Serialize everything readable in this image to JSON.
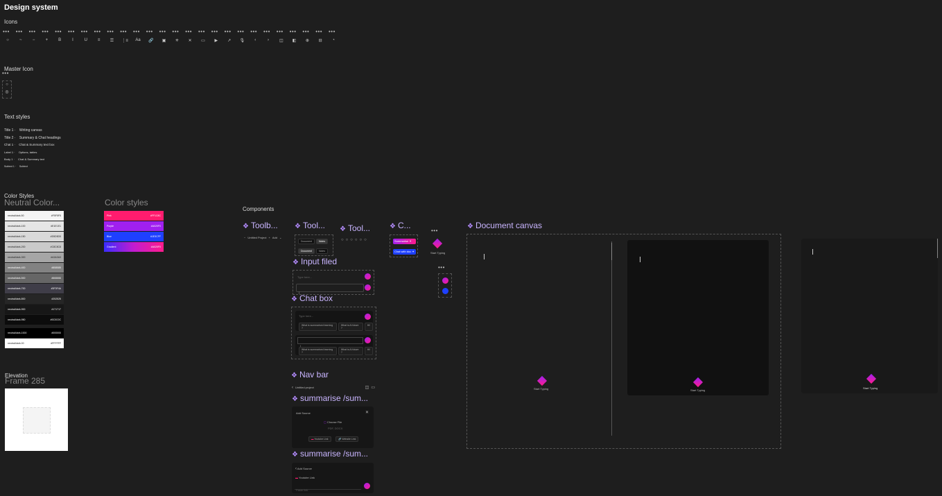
{
  "page": {
    "title": "Design system",
    "icons_label": "Icons",
    "master_icon_label": "Master Icon",
    "text_styles_label": "Text styles",
    "color_styles_label": "Color Styles",
    "neutral_colors_label": "Neutral Color...",
    "color_styles_big_label": "Color styles",
    "elevation_label": "Elevation",
    "frame_label": "Frame 285",
    "components_label": "Components"
  },
  "icons": [
    "○",
    "~",
    "−",
    "+",
    "B",
    "I",
    "U",
    "≡",
    "☰",
    "⋮≡",
    "Aa",
    "🔗",
    "▣",
    "✳",
    "✕",
    "▭",
    "▶",
    "↗",
    "🎙",
    "‹",
    "›",
    "◫",
    "◧",
    "⊕",
    "⊟",
    "◔"
  ],
  "text_styles": [
    {
      "name": "Title 1",
      "sample": "Writing canvas"
    },
    {
      "name": "Title 2",
      "sample": "Summary & Chat headings"
    },
    {
      "name": "Chat 1",
      "sample": "Chat & Summary text box"
    },
    {
      "name": "Label 1",
      "sample": "Options, tables"
    },
    {
      "name": "Body 1",
      "sample": "Chat & Summary text"
    },
    {
      "name": "Subtext 1",
      "sample": "Subtext"
    }
  ],
  "neutral_colors": [
    {
      "name": "neutral/dark-50",
      "hex": "#F5F5F5",
      "bg": "#f5f5f5",
      "fg": "#222"
    },
    {
      "name": "neutral/dark-100",
      "hex": "#E1E1E1",
      "bg": "#e6e6e6",
      "fg": "#222"
    },
    {
      "name": "neutral/dark-150",
      "hex": "#D5D5D5",
      "bg": "#d9d9d9",
      "fg": "#222"
    },
    {
      "name": "neutral/dark-200",
      "hex": "#C8C8C8",
      "bg": "#cacaca",
      "fg": "#222"
    },
    {
      "name": "neutral/dark-300",
      "hex": "#A3A3A3",
      "bg": "#a6a6a6",
      "fg": "#222"
    },
    {
      "name": "neutral/dark-400",
      "hex": "#858585",
      "bg": "#828282",
      "fg": "#fff"
    },
    {
      "name": "neutral/dark-500",
      "hex": "#666666",
      "bg": "#666666",
      "fg": "#fff"
    },
    {
      "name": "neutral/dark-700",
      "hex": "#3F3F4A",
      "bg": "#3f3d48",
      "fg": "#fff"
    },
    {
      "name": "neutral/dark-800",
      "hex": "#252525",
      "bg": "#262626",
      "fg": "#fff"
    },
    {
      "name": "neutral/dark-900",
      "hex": "#171717",
      "bg": "#171717",
      "fg": "#fff"
    },
    {
      "name": "neutral/dark-950",
      "hex": "#0C0C0C",
      "bg": "#0c0c0c",
      "fg": "#fff"
    },
    {
      "name": "neutral/dark-1000",
      "hex": "#000000",
      "bg": "#000000",
      "fg": "#fff"
    },
    {
      "name": "neutral/dark-00",
      "hex": "#FFFFFF",
      "bg": "#ffffff",
      "fg": "#222"
    }
  ],
  "color_styles": [
    {
      "name": "Pink",
      "hex": "#FF1C8C",
      "bg": "#ff1c6e"
    },
    {
      "name": "Purple",
      "hex": "#A020F0",
      "bg": "#a020f0"
    },
    {
      "name": "Blue",
      "hex": "#1E3CFF",
      "bg": "#1e40ff"
    },
    {
      "name": "Gradient",
      "hex": "#A020F0",
      "bg": "linear-gradient(90deg,#3a2cff,#c21cd0,#ff1c8c)"
    }
  ],
  "components": {
    "toolbar1": {
      "title": "Toolb...",
      "doc": "Untitled Project",
      "add": "Add"
    },
    "toolbar2": {
      "title": "Tool...",
      "doc": "Document",
      "notes": "Notes"
    },
    "toolbar3": {
      "title": "Tool..."
    },
    "c": {
      "title": "C...",
      "btn1": "Summarise",
      "btn2": "Chat with doc"
    },
    "input": {
      "title": "Input filed",
      "placeholder": "Type here..."
    },
    "chat": {
      "title": "Chat box",
      "placeholder": "Type here...",
      "s1": "What is summarised learning ?",
      "s2": "What is AI future ?",
      "s3": "Hi!"
    },
    "nav": {
      "title": "Nav bar",
      "name": "Untitled project"
    },
    "sum1": {
      "title": "summarise /sum...",
      "heading": "Add Source",
      "choose": "Choose File",
      "hint": "PDF, DOCX",
      "yt": "Youtube Link",
      "web": "Website Link"
    },
    "sum2": {
      "title": "summarise /sum...",
      "heading": "Add Source",
      "yt": "Youtube Link",
      "placeholder": "Paste link"
    },
    "canvas": {
      "title": "Document canvas",
      "typing": "Start Typing"
    }
  }
}
